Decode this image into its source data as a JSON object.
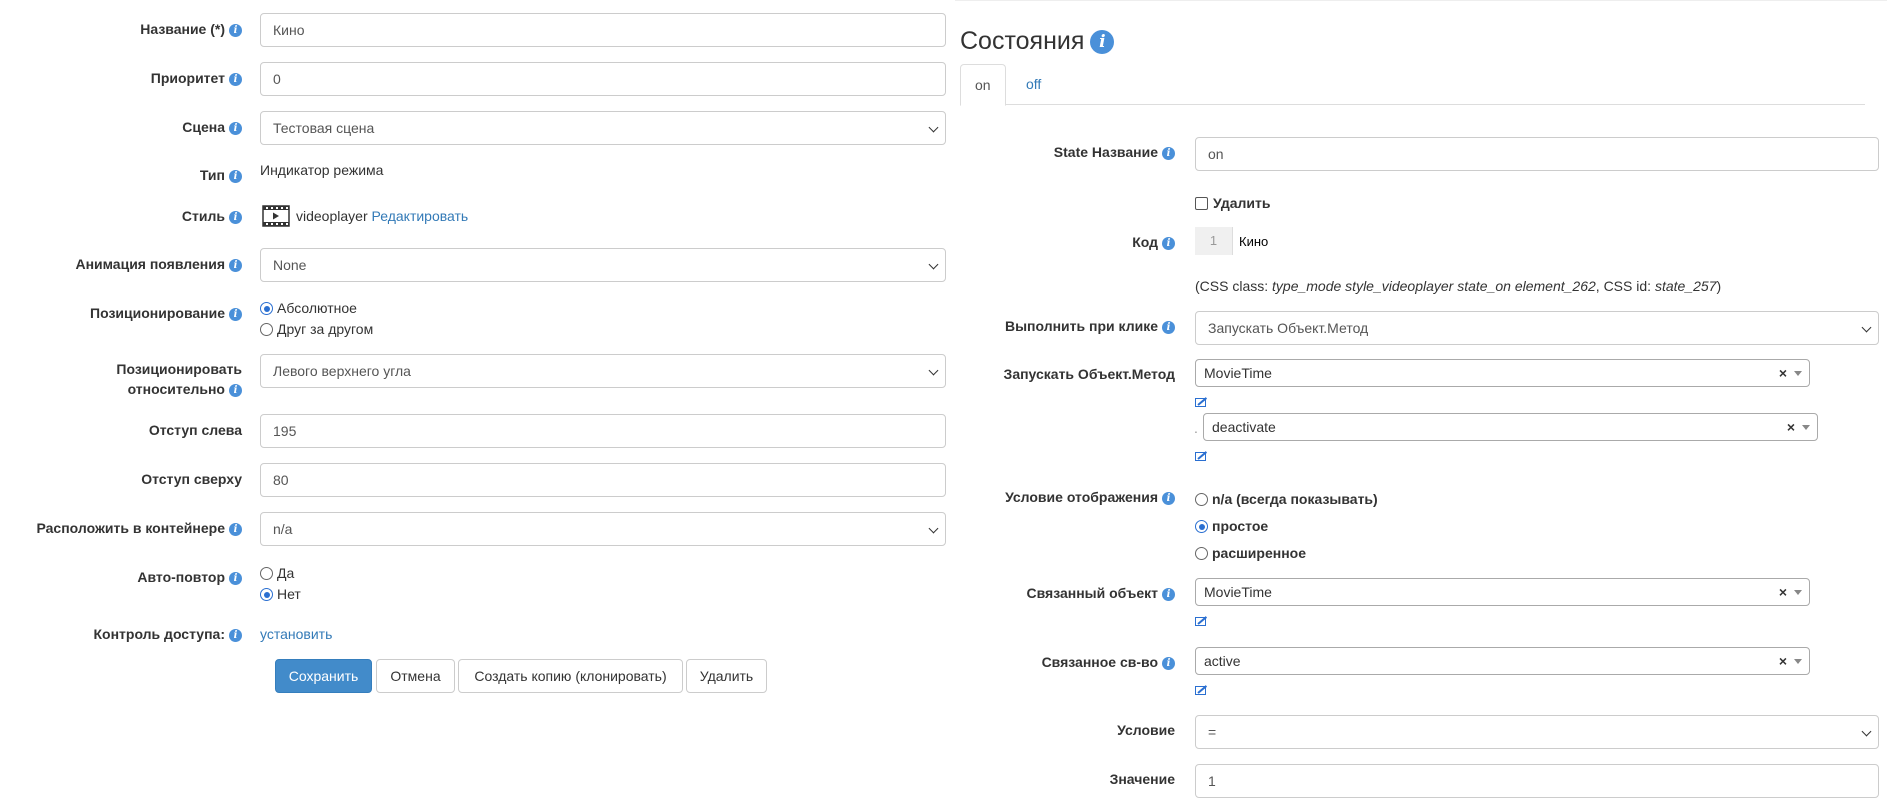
{
  "form": {
    "name": {
      "label": "Название (*)",
      "value": "Кино"
    },
    "priority": {
      "label": "Приоритет",
      "value": "0"
    },
    "scene": {
      "label": "Сцена",
      "value": "Тестовая сцена"
    },
    "type": {
      "label": "Тип",
      "value": "Индикатор режима"
    },
    "style": {
      "label": "Стиль",
      "value": "videoplayer",
      "edit_link": "Редактировать",
      "icon": "film-icon"
    },
    "appear_anim": {
      "label": "Анимация появления",
      "value": "None"
    },
    "positioning": {
      "label": "Позиционирование",
      "options": [
        "Абсолютное",
        "Друг за другом"
      ],
      "selected": "Абсолютное"
    },
    "position_rel": {
      "label_line1": "Позиционировать",
      "label_line2": "относительно",
      "value": "Левого верхнего угла"
    },
    "left_offset": {
      "label": "Отступ слева",
      "value": "195"
    },
    "top_offset": {
      "label": "Отступ сверху",
      "value": "80"
    },
    "container": {
      "label": "Расположить в контейнере",
      "value": "n/a"
    },
    "autorepeat": {
      "label": "Авто-повтор",
      "options": [
        "Да",
        "Нет"
      ],
      "selected": "Нет"
    },
    "access": {
      "label": "Контроль доступа:",
      "link": "установить"
    },
    "buttons": {
      "save": "Сохранить",
      "cancel": "Отмена",
      "clone": "Создать копию (клонировать)",
      "delete": "Удалить"
    }
  },
  "states": {
    "title": "Состояния",
    "tabs": [
      "on",
      "off"
    ],
    "active_tab": "on",
    "state_name": {
      "label": "State Название",
      "value": "on"
    },
    "delete_label": "Удалить",
    "code": {
      "label": "Код",
      "line_no": "1",
      "text": "Кино"
    },
    "css_info": {
      "prefix": "(CSS class: ",
      "css_class": "type_mode style_videoplayer state_on element_262",
      "mid": ", CSS id: ",
      "css_id": "state_257",
      "suffix": ")"
    },
    "on_click": {
      "label": "Выполнить при клике",
      "value": "Запускать Объект.Метод"
    },
    "run_method": {
      "label": "Запускать Объект.Метод",
      "object": "MovieTime",
      "method": "deactivate",
      "separator": "."
    },
    "display_cond": {
      "label": "Условие отображения",
      "options": [
        "n/a (всегда показывать)",
        "простое",
        "расширенное"
      ],
      "selected": "простое"
    },
    "linked_object": {
      "label": "Связанный объект",
      "value": "MovieTime"
    },
    "linked_prop": {
      "label": "Связанное св-во",
      "value": "active"
    },
    "condition": {
      "label": "Условие",
      "value": "="
    },
    "value": {
      "label": "Значение",
      "value": "1"
    }
  },
  "colors": {
    "accent": "#428bca",
    "link": "#337ab7",
    "info_icon": "#4a90d9"
  },
  "icons": {
    "info": "info-icon",
    "clear": "clear-icon",
    "dropdown": "chevron-down-icon",
    "external": "external-link-icon"
  }
}
